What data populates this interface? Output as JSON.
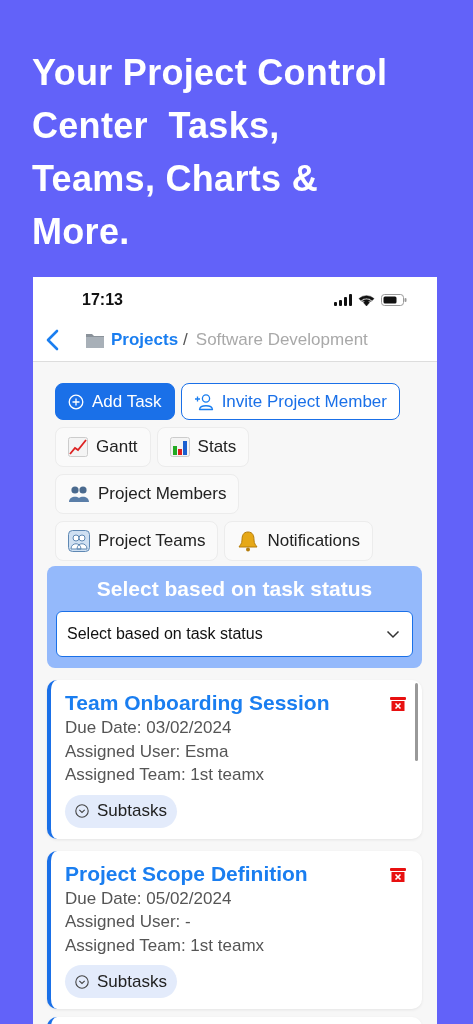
{
  "headline": "Your Project Control\nCenter  Tasks,\nTeams, Charts &\nMore.",
  "status_bar": {
    "time": "17:13"
  },
  "nav": {
    "breadcrumb": "Projects",
    "separator": "/",
    "current": "Software Development"
  },
  "actions": [
    {
      "label": "Add Task",
      "kind": "add"
    },
    {
      "label": "Invite Project Member",
      "kind": "invite"
    },
    {
      "label": "Gantt",
      "kind": "gantt"
    },
    {
      "label": "Stats",
      "kind": "stats"
    },
    {
      "label": "Project Members",
      "kind": "members"
    },
    {
      "label": "Project Teams",
      "kind": "teams"
    },
    {
      "label": "Notifications",
      "kind": "notifications"
    }
  ],
  "filter": {
    "title": "Select based on task status",
    "value": "Select based on task status"
  },
  "tasks": [
    {
      "title": "Team Onboarding Session",
      "due": "Due Date: 03/02/2024",
      "user": "Assigned User: Esma",
      "team": "Assigned Team: 1st teamx",
      "subtasks": "Subtasks"
    },
    {
      "title": "Project Scope Definition",
      "due": "Due Date: 05/02/2024",
      "user": "Assigned User: -",
      "team": "Assigned Team: 1st teamx",
      "subtasks": "Subtasks"
    }
  ]
}
